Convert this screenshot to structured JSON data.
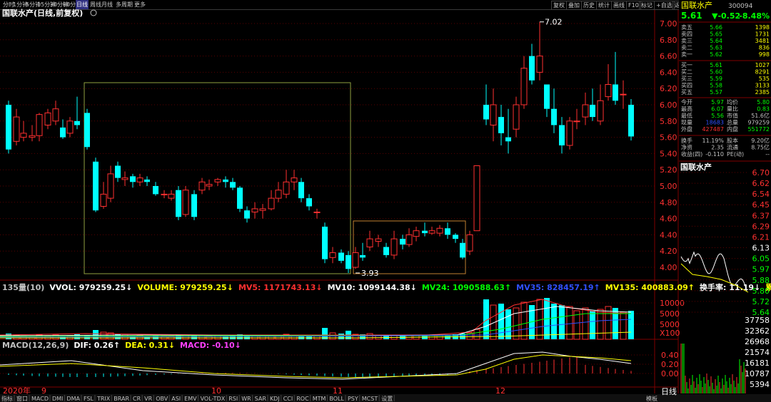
{
  "toolbar": {
    "timeframes": [
      "分时",
      "1分钟",
      "5分钟",
      "15分钟",
      "30分钟",
      "60分钟",
      "日线",
      "周线",
      "月线",
      "多周期",
      "更多"
    ],
    "active_timeframe": "日线",
    "right_buttons": [
      "复权",
      "叠加",
      "历史",
      "统计",
      "画线",
      "F10",
      "标记",
      "+自选",
      "返回"
    ]
  },
  "chart": {
    "title": "国联水产(日线,前复权)",
    "high_label": "7.02",
    "low_label": "3.93",
    "price_axis": [
      "7.00",
      "6.80",
      "6.60",
      "6.40",
      "6.20",
      "6.00",
      "5.80",
      "5.60",
      "5.40",
      "5.20",
      "5.00",
      "4.80",
      "4.60",
      "4.40",
      "4.20",
      "4.00"
    ]
  },
  "volume_panel": {
    "header": [
      {
        "text": "135量(10)",
        "color": "#c0c0c0"
      },
      {
        "text": "VVOL: 979259.25↓",
        "color": "#ffffff"
      },
      {
        "text": "VOLUME: 979259.25↓",
        "color": "#ffff00"
      },
      {
        "text": "MV5: 1171743.13↓",
        "color": "#ff3030"
      },
      {
        "text": "MV10: 1099144.38↓",
        "color": "#ffffff"
      },
      {
        "text": "MV24: 1090588.63↑",
        "color": "#00ff00"
      },
      {
        "text": "MV35: 828457.19↑",
        "color": "#3050ff"
      },
      {
        "text": "MV135: 400883.09↑",
        "color": "#ffff00"
      },
      {
        "text": "换手率: 11.19↓",
        "color": "#ffffff"
      },
      {
        "text": "累计换",
        "color": "#ffff00"
      }
    ],
    "axis": [
      "10000",
      "5000",
      "5000",
      "X100"
    ]
  },
  "macd_panel": {
    "header": [
      {
        "text": "MACD(12,26,9)",
        "color": "#c0c0c0"
      },
      {
        "text": "DIF: 0.26↑",
        "color": "#ffffff"
      },
      {
        "text": "DEA: 0.31↓",
        "color": "#ffff00"
      },
      {
        "text": "MACD: -0.10↓",
        "color": "#ff40ff"
      }
    ],
    "axis": [
      "0.40",
      "0.20",
      "0.00"
    ]
  },
  "date_axis": [
    {
      "label": "2020年",
      "color": "#ff3030"
    },
    {
      "label": "9",
      "color": "#ff3030"
    },
    {
      "label": "10",
      "color": "#ff3030"
    },
    {
      "label": "11",
      "color": "#ff3030"
    },
    {
      "label": "12",
      "color": "#ff3030"
    }
  ],
  "bottom_tabs": [
    "指标",
    "窗口",
    "MACD",
    "DMI",
    "DMA",
    "FSL",
    "TRIX",
    "BRAR",
    "CR",
    "VR",
    "OBV",
    "ASI",
    "EMV",
    "VOL-TDX",
    "RSI",
    "WR",
    "SAR",
    "KDJ",
    "CCI",
    "ROC",
    "MTM",
    "BOLL",
    "PSY",
    "MCST",
    "设置"
  ],
  "bottom_right": [
    "模板",
    "日线"
  ],
  "quote": {
    "name": "国联水产",
    "code": "300094",
    "price": "5.61",
    "change": "▼-0.52",
    "pct": "-8.48%",
    "sells": [
      {
        "label": "卖五",
        "price": "5.66",
        "vol": "1398"
      },
      {
        "label": "卖四",
        "price": "5.65",
        "vol": "1731"
      },
      {
        "label": "卖三",
        "price": "5.64",
        "vol": "3481"
      },
      {
        "label": "卖二",
        "price": "5.63",
        "vol": "836"
      },
      {
        "label": "卖一",
        "price": "5.62",
        "vol": "998"
      }
    ],
    "buys": [
      {
        "label": "买一",
        "price": "5.61",
        "vol": "1027"
      },
      {
        "label": "买二",
        "price": "5.60",
        "vol": "8291"
      },
      {
        "label": "买三",
        "price": "5.59",
        "vol": "535"
      },
      {
        "label": "买四",
        "price": "5.58",
        "vol": "3133"
      },
      {
        "label": "买五",
        "price": "5.57",
        "vol": "2385"
      }
    ],
    "stats": [
      {
        "l1": "今开",
        "v1": "5.97",
        "c1": "#00ff00",
        "l2": "均价",
        "v2": "5.80",
        "c2": "#00ff00"
      },
      {
        "l1": "最高",
        "v1": "6.07",
        "c1": "#00ff00",
        "l2": "量比",
        "v2": "0.83",
        "c2": "#00ff00"
      },
      {
        "l1": "最低",
        "v1": "5.56",
        "c1": "#00ff00",
        "l2": "市值",
        "v2": "51.6亿",
        "c2": "#c0c0c0"
      },
      {
        "l1": "现量",
        "v1": "18683",
        "c1": "#3050ff",
        "l2": "总量",
        "v2": "979259",
        "c2": "#c0c0c0"
      },
      {
        "l1": "外盘",
        "v1": "427487",
        "c1": "#ff3030",
        "l2": "内盘",
        "v2": "551772",
        "c2": "#00ff00"
      }
    ],
    "stats2": [
      {
        "l1": "换手",
        "v1": "11.19%",
        "l2": "股本",
        "v2": "9.20亿"
      },
      {
        "l1": "净资",
        "v1": "2.35",
        "l2": "流通",
        "v2": "8.75亿"
      },
      {
        "l1": "收益(四)",
        "v1": "-0.110",
        "l2": "PE(动)",
        "v2": "--"
      }
    ]
  },
  "mini": {
    "title": "国联水产",
    "axis_top": [
      "6.70",
      "6.62",
      "6.54",
      "6.45",
      "6.37",
      "6.29",
      "6.21",
      "6.13",
      "6.05",
      "5.97",
      "5.88",
      "5.80",
      "5.72",
      "5.64"
    ],
    "axis_vol": [
      "37758",
      "32362",
      "26968",
      "21574",
      "16181",
      "10787",
      "5394"
    ]
  },
  "colors": {
    "up": "#ff3030",
    "down": "#00ffff",
    "grid": "#5a0000",
    "box": "#a08030"
  }
}
